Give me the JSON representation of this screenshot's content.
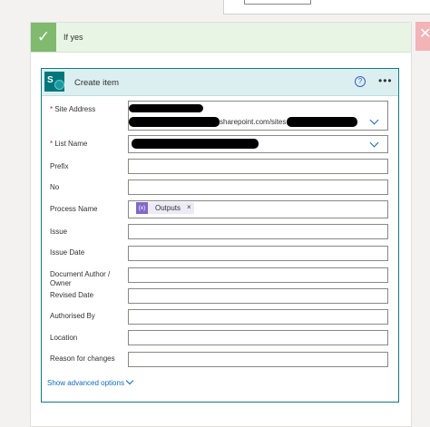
{
  "condition": {
    "title": "If yes"
  },
  "action": {
    "title": "Create item",
    "help_icon": "question-circle-icon",
    "more_icon": "ellipsis-icon",
    "connector_icon": "sharepoint-icon"
  },
  "fields": {
    "site_address": {
      "label": "Site Address",
      "required": true,
      "value_visible": "sharepoint.com/sites"
    },
    "list_name": {
      "label": "List Name",
      "required": true
    },
    "prefix": {
      "label": "Prefix",
      "value": ""
    },
    "no": {
      "label": "No",
      "value": ""
    },
    "process_name": {
      "label": "Process Name",
      "token": "Outputs",
      "token_remove": "×"
    },
    "issue": {
      "label": "Issue",
      "value": ""
    },
    "issue_date": {
      "label": "Issue Date",
      "value": ""
    },
    "document_author": {
      "label": "Document Author /\nOwner",
      "value": ""
    },
    "revised_date": {
      "label": "Revised Date",
      "value": ""
    },
    "authorised_by": {
      "label": "Authorised By",
      "value": ""
    },
    "location": {
      "label": "Location",
      "value": ""
    },
    "reason_for_changes": {
      "label": "Reason for changes",
      "value": ""
    }
  },
  "footer": {
    "advanced_options": "Show advanced options"
  },
  "colors": {
    "accent": "#0f7c82",
    "success": "#7fba6e",
    "link": "#0f6cbd",
    "required": "#a4262c",
    "token": "#8068c7"
  }
}
